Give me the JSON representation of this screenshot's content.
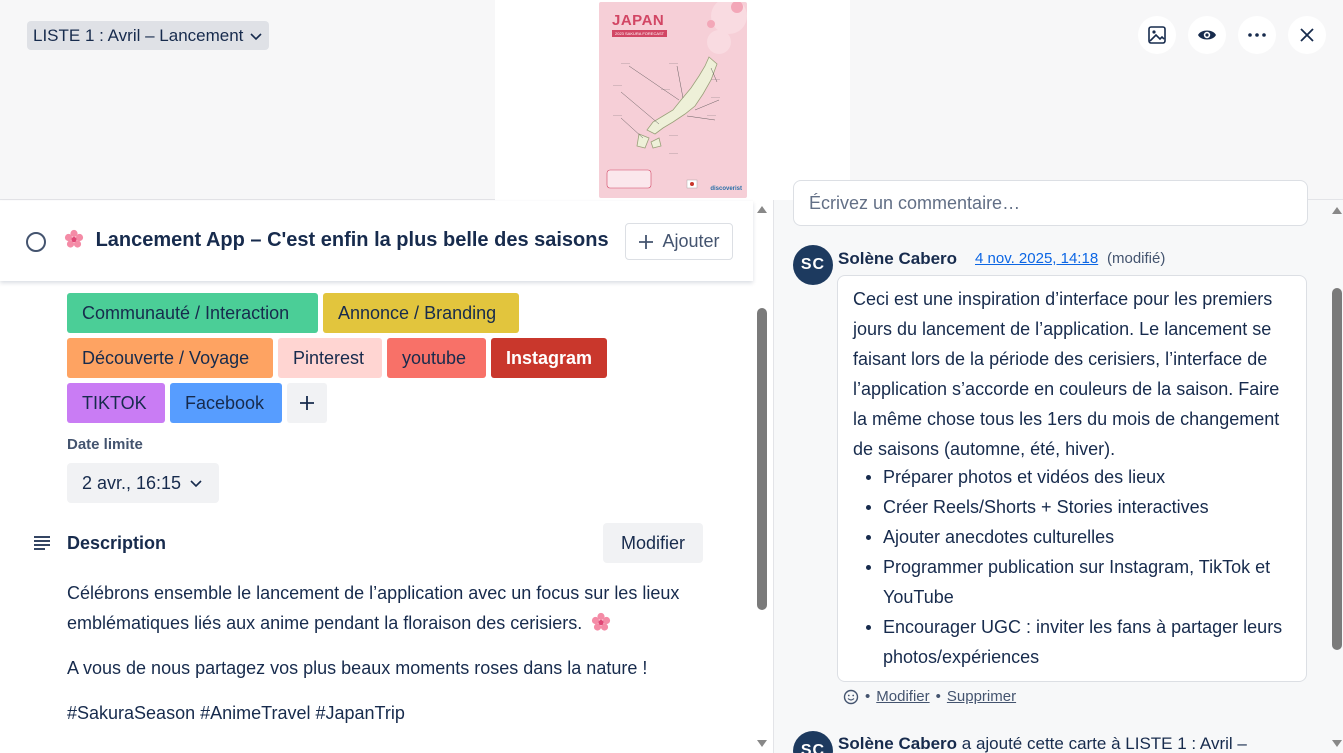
{
  "header": {
    "list_selector": "LISTE 1 : Avril – Lancement",
    "cover": {
      "title": "JAPAN",
      "subtitle": "2023 SAKURA FORECAST",
      "brand": "discoverist"
    }
  },
  "card": {
    "title": "Lancement App – C'est enfin la plus belle des saisons",
    "add_button": "Ajouter"
  },
  "labels": [
    {
      "text": "Communauté / Interaction",
      "color": "#4bce97"
    },
    {
      "text": "Annonce / Branding",
      "color": "#e2c53d"
    },
    {
      "text": "Découverte / Voyage",
      "color": "#fea362"
    },
    {
      "text": "Pinterest",
      "color": "#ffd5d2"
    },
    {
      "text": "youtube",
      "color": "#f87168"
    },
    {
      "text": "Instagram",
      "color": "#c9372c"
    },
    {
      "text": "TIKTOK",
      "color": "#c97cf4"
    },
    {
      "text": "Facebook",
      "color": "#579dff"
    }
  ],
  "due": {
    "label": "Date limite",
    "value": "2 avr., 16:15"
  },
  "description": {
    "title": "Description",
    "modify_button": "Modifier",
    "paragraphs": [
      "Célébrons ensemble le lancement de l’application avec un focus sur les lieux emblématiques liés aux anime pendant la floraison des cerisiers.",
      "A vous de nous partagez vos plus beaux moments roses dans la nature !",
      "#SakuraSeason #AnimeTravel #JapanTrip"
    ]
  },
  "comments": {
    "placeholder": "Écrivez un commentaire…",
    "items": [
      {
        "initials": "SC",
        "author": "Solène Cabero",
        "date": "4 nov. 2025, 14:18",
        "edited": "(modifié)",
        "text": "Ceci est une inspiration d’interface pour les premiers jours du lancement de l’application. Le lancement se faisant lors de la période des cerisiers, l’interface de l’application s’accorde en couleurs de la saison. Faire la même chose tous les 1ers du mois de changement de saisons (automne, été, hiver).",
        "bullets": [
          "Préparer photos et vidéos des lieux",
          "Créer Reels/Shorts + Stories interactives",
          "Ajouter anecdotes culturelles",
          "Programmer publication sur Instagram, TikTok et YouTube",
          "Encourager UGC : inviter les fans à partager leurs photos/expériences"
        ],
        "actions": {
          "modify": "Modifier",
          "delete": "Supprimer"
        }
      }
    ],
    "activity": {
      "initials": "SC",
      "author": "Solène Cabero",
      "text": " a ajouté cette carte à LISTE 1 : Avril –"
    }
  }
}
